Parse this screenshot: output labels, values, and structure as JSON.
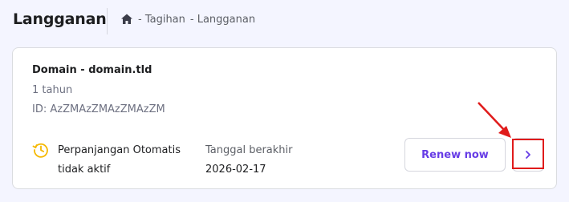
{
  "header": {
    "title": "Langganan",
    "breadcrumb": {
      "home_icon": "home-icon",
      "items": [
        "- Tagihan",
        "- Langganan"
      ]
    }
  },
  "subscription": {
    "domain": "Domain - domain.tld",
    "period": "1 tahun",
    "id_label": "ID: AzZMAzZMAzZMAzZM",
    "auto_renew": {
      "icon": "clock-renew-icon",
      "line1": "Perpanjangan Otomatis",
      "line2": "tidak aktif"
    },
    "expiry": {
      "label": "Tanggal berakhir",
      "value": "2026-02-17"
    },
    "renew_button": "Renew now",
    "next_icon": "chevron-right-icon"
  },
  "colors": {
    "background": "#f4f5ff",
    "accent": "#673de6",
    "annotation": "#e01b1b",
    "clock_icon": "#f5b800"
  }
}
